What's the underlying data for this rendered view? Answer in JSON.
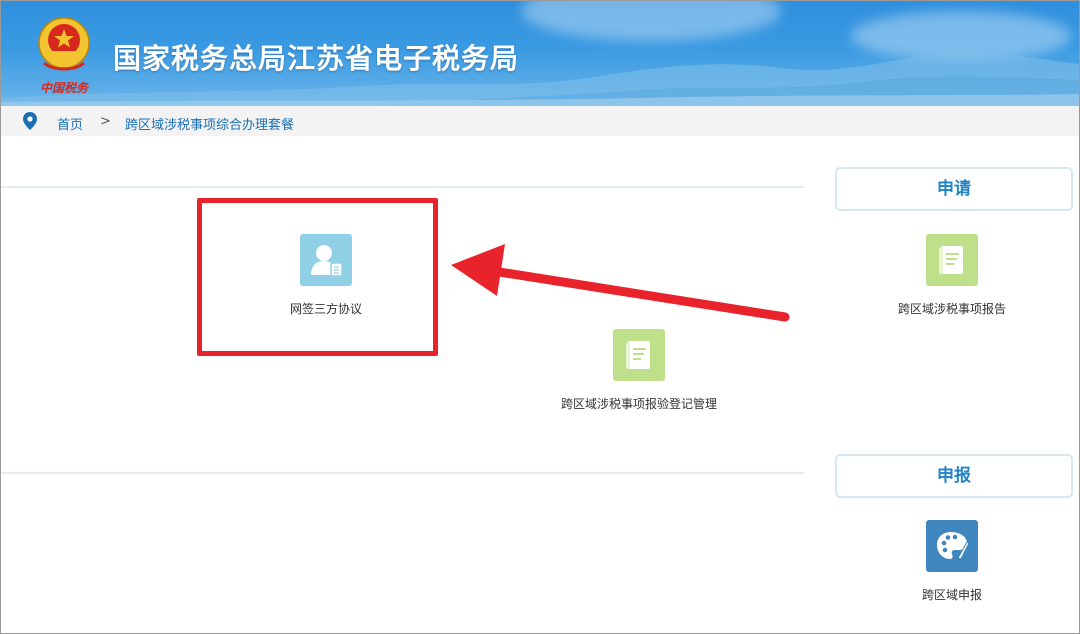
{
  "header": {
    "title": "国家税务总局江苏省电子税务局",
    "logo_caption": "中国税务"
  },
  "breadcrumb": {
    "home": "首页",
    "separator": ">",
    "current": "跨区域涉税事项综合办理套餐"
  },
  "main": {
    "tiles": [
      {
        "label": "网签三方协议",
        "icon": "user-contract-icon"
      },
      {
        "label": "跨区域涉税事项报验登记管理",
        "icon": "document-book-icon"
      }
    ]
  },
  "side": {
    "apply": {
      "title": "申请",
      "tiles": [
        {
          "label": "跨区域涉税事项报告",
          "icon": "document-book-icon"
        }
      ]
    },
    "declare": {
      "title": "申报",
      "tiles": [
        {
          "label": "跨区域申报",
          "icon": "palette-icon"
        }
      ]
    }
  },
  "colors": {
    "banner": "#2f8fdd",
    "link": "#1a6fb5",
    "section_title": "#1f84c8",
    "annotation": "#e8232b",
    "tile_blue": "#8fd0e6",
    "tile_green": "#bfe08a",
    "tile_dark_blue": "#3f86bf"
  }
}
